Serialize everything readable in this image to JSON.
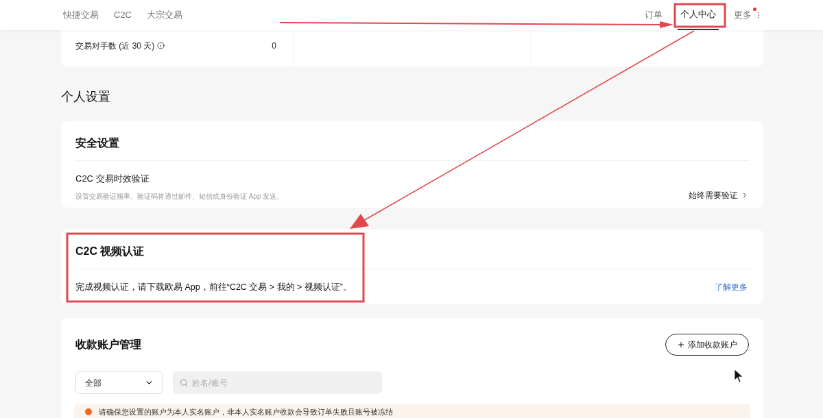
{
  "nav": {
    "left": [
      {
        "label": "快捷交易",
        "selected": false
      },
      {
        "label": "C2C",
        "selected": false
      },
      {
        "label": "大宗交易",
        "selected": false
      }
    ],
    "right": [
      {
        "label": "订单",
        "selected": false,
        "badge": false
      },
      {
        "label": "个人中心",
        "selected": true,
        "badge": false
      },
      {
        "label": "更多",
        "selected": false,
        "badge": true
      }
    ]
  },
  "stats": {
    "label": "交易对手数 (近 30 天)",
    "value": "0"
  },
  "section_title": "个人设置",
  "security": {
    "title": "安全设置",
    "item_title": "C2C 交易时效验证",
    "item_desc": "设置交易验证频率。验证码将通过邮件、短信或身份验证 App 发送。",
    "action": "始终需要验证"
  },
  "video": {
    "title": "C2C 视频认证",
    "text": "完成视频认证，请下载欧易 App，前往“C2C 交易 > 我的 > 视频认证”。",
    "link": "了解更多"
  },
  "accounts": {
    "title": "收款账户管理",
    "add_button": "添加收款账户",
    "filter": "全部",
    "search": {
      "placeholder": "姓名/账号"
    },
    "warning": "请确保您设置的账户为本人实名账户，非本人实名账户收款会导致订单失败且账号被冻结"
  }
}
